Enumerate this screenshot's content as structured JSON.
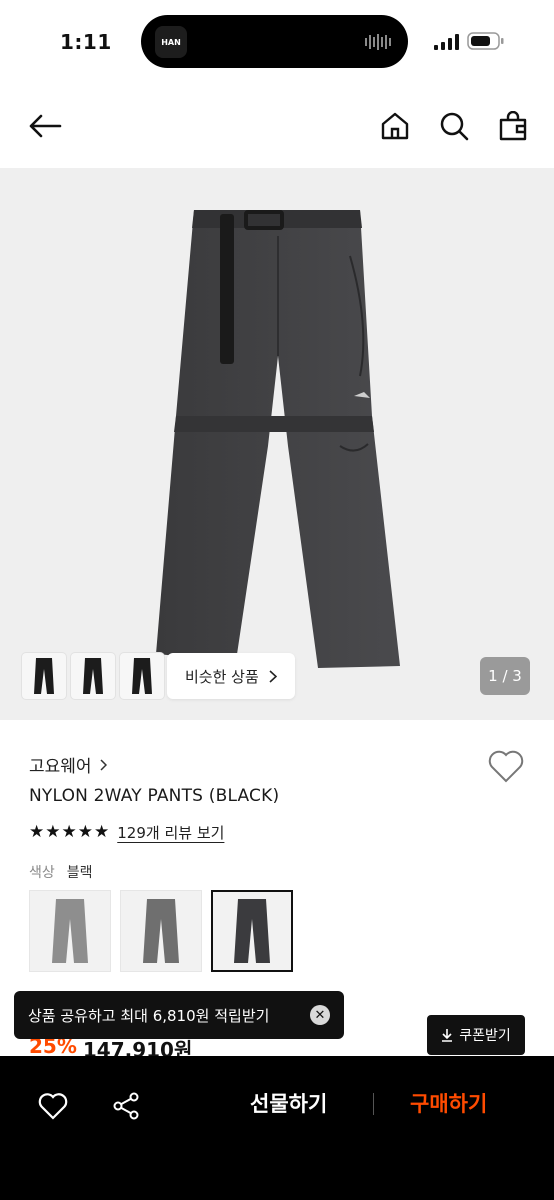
{
  "status_bar": {
    "time": "1:11",
    "island_app": "HAN"
  },
  "nav": {
    "back_icon": "arrow-left-icon",
    "home_icon": "home-icon",
    "search_icon": "search-icon",
    "cart_icon": "shopping-bag-icon"
  },
  "gallery": {
    "similar_label": "비슷한 상품",
    "pager": "1 / 3",
    "thumbnail_count": 3
  },
  "product": {
    "brand": "고요웨어",
    "name": "NYLON 2WAY PANTS (BLACK)",
    "rating_stars": 5,
    "review_link": "129개 리뷰 보기",
    "color_label": "색상",
    "color_value": "블랙",
    "swatches": [
      "light-gray",
      "gray",
      "black"
    ],
    "selected_swatch": 2,
    "discount": "25%",
    "price": "147,910원"
  },
  "toast": {
    "message": "상품 공유하고 최대 6,810원 적립받기"
  },
  "coupon": {
    "label": "쿠폰받기"
  },
  "bottom_bar": {
    "gift_label": "선물하기",
    "buy_label": "구매하기"
  },
  "colors": {
    "accent": "#ff4b00",
    "bar": "#000000",
    "hero_bg": "#efefef"
  }
}
